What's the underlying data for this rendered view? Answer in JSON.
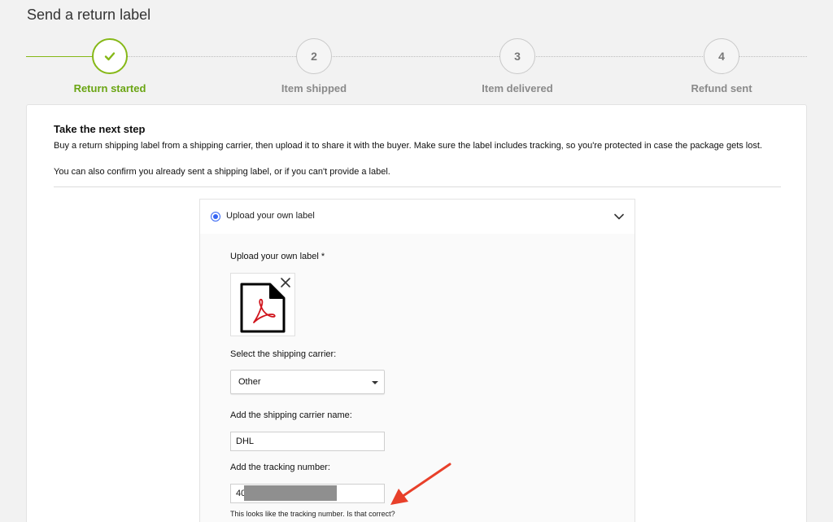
{
  "page": {
    "title": "Send a return label"
  },
  "stepper": {
    "steps": [
      {
        "number": "",
        "label": "Return started",
        "status": "done"
      },
      {
        "number": "2",
        "label": "Item shipped",
        "status": "pending"
      },
      {
        "number": "3",
        "label": "Item delivered",
        "status": "pending"
      },
      {
        "number": "4",
        "label": "Refund sent",
        "status": "pending"
      }
    ]
  },
  "next_step": {
    "title": "Take the next step",
    "description": "Buy a return shipping label from a shipping carrier, then upload it to share it with the buyer. Make sure the label includes tracking, so you're protected in case the package gets lost.",
    "description2": "You can also confirm you already sent a shipping label, or if you can't provide a label."
  },
  "upload_option": {
    "label": "Upload your own label",
    "selected": true
  },
  "form": {
    "upload_label": "Upload your own label *",
    "carrier_label": "Select the shipping carrier:",
    "carrier_value": "Other",
    "carrier_name_label": "Add the shipping carrier name:",
    "carrier_name_value": "DHL",
    "tracking_label": "Add the tracking number:",
    "tracking_value": "40",
    "tracking_hint": "This looks like the tracking number. Is that correct?"
  },
  "colors": {
    "accent_green": "#86b817",
    "label_green": "#6aa513",
    "radio_blue": "#3665f3",
    "pdf_red": "#d0141c",
    "annotation_arrow": "#e8402a"
  },
  "icons": {
    "step1": "checkmark-icon",
    "option_toggle": "chevron-down-icon",
    "file": "pdf-file-icon",
    "remove": "close-icon",
    "annotation": "red-arrow-icon"
  }
}
